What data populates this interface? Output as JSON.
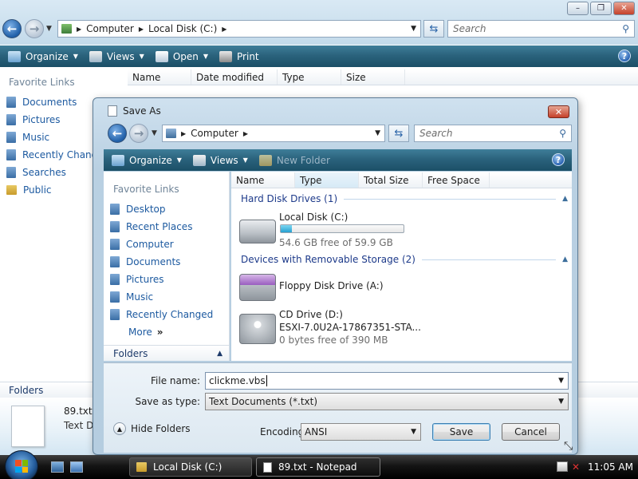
{
  "explorer": {
    "window_controls": [
      "–",
      "❐",
      "✕"
    ],
    "address_crumbs": [
      "Computer",
      "Local Disk (C:)"
    ],
    "search_placeholder": "Search",
    "toolbar": {
      "organize": "Organize",
      "views": "Views",
      "open": "Open",
      "print": "Print"
    },
    "columns": [
      "Name",
      "Date modified",
      "Type",
      "Size"
    ],
    "favorite_links_title": "Favorite Links",
    "favorite_links": [
      "Documents",
      "Pictures",
      "Music",
      "Recently Changed",
      "Searches",
      "Public"
    ],
    "folders_label": "Folders",
    "details": {
      "filename": "89.txt",
      "type": "Text Doc"
    }
  },
  "dialog": {
    "title": "Save As",
    "address_crumbs": [
      "Computer"
    ],
    "search_placeholder": "Search",
    "toolbar": {
      "organize": "Organize",
      "views": "Views",
      "new_folder": "New Folder"
    },
    "columns": [
      "Name",
      "Type",
      "Total Size",
      "Free Space"
    ],
    "favorite_links_title": "Favorite Links",
    "favorite_links": [
      "Desktop",
      "Recent Places",
      "Computer",
      "Documents",
      "Pictures",
      "Music",
      "Recently Changed"
    ],
    "more_label": "More",
    "more_chevron": "»",
    "folders_label": "Folders",
    "groups": [
      {
        "title": "Hard Disk Drives (1)",
        "items": [
          {
            "name": "Local Disk (C:)",
            "free_text": "54.6 GB free of 59.9 GB",
            "used_fraction": 0.09
          }
        ]
      },
      {
        "title": "Devices with Removable Storage (2)",
        "items": [
          {
            "name": "Floppy Disk Drive (A:)"
          },
          {
            "name": "CD Drive (D:)",
            "label": "ESXI-7.0U2A-17867351-STA...",
            "free_text": "0 bytes free of 390 MB"
          }
        ]
      }
    ],
    "file_name_label": "File name:",
    "file_name_value": "clickme.vbs",
    "save_as_type_label": "Save as type:",
    "save_as_type_value": "Text Documents (*.txt)",
    "hide_folders_label": "Hide Folders",
    "encoding_label": "Encoding:",
    "encoding_value": "ANSI",
    "save_button": "Save",
    "cancel_button": "Cancel"
  },
  "taskbar": {
    "tasks": [
      "Local Disk (C:)",
      "89.txt - Notepad"
    ],
    "clock": "11:05 AM"
  },
  "colors": {
    "toolbar": "#2b637d",
    "link": "#1d5aa0",
    "group_header": "#1d3a8a",
    "progress": "#26a0d0"
  }
}
